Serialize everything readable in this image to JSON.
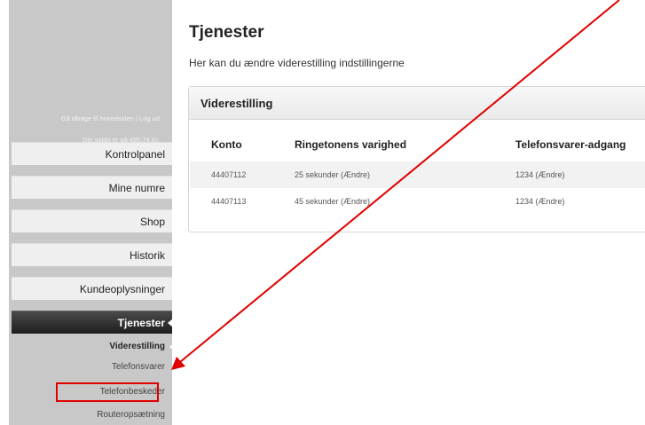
{
  "sidebar": {
    "back_link": "Gå tilbage til hovedsiden | Log ud",
    "balance": "Din saldo er på 485,74 Kr.",
    "nav": [
      "Kontrolpanel",
      "Mine numre",
      "Shop",
      "Historik",
      "Kundeoplysninger"
    ],
    "active_nav": "Tjenester",
    "sub": [
      "Viderestilling",
      "Telefonsvarer",
      "Telefonbeskeder",
      "Routeropsætning"
    ]
  },
  "main": {
    "title": "Tjenester",
    "subtitle": "Her kan du ændre viderestilling indstillingerne",
    "panel_title": "Viderestilling",
    "headers": [
      "Konto",
      "Ringetonens varighed",
      "Telefonsvarer-adgang"
    ],
    "rows": [
      [
        "44407112",
        "25 sekunder (Ændre)",
        "1234 (Ændre)"
      ],
      [
        "44407113",
        "45 sekunder (Ændre)",
        "1234 (Ændre)"
      ]
    ]
  },
  "annotation": {
    "color": "#e00000"
  }
}
